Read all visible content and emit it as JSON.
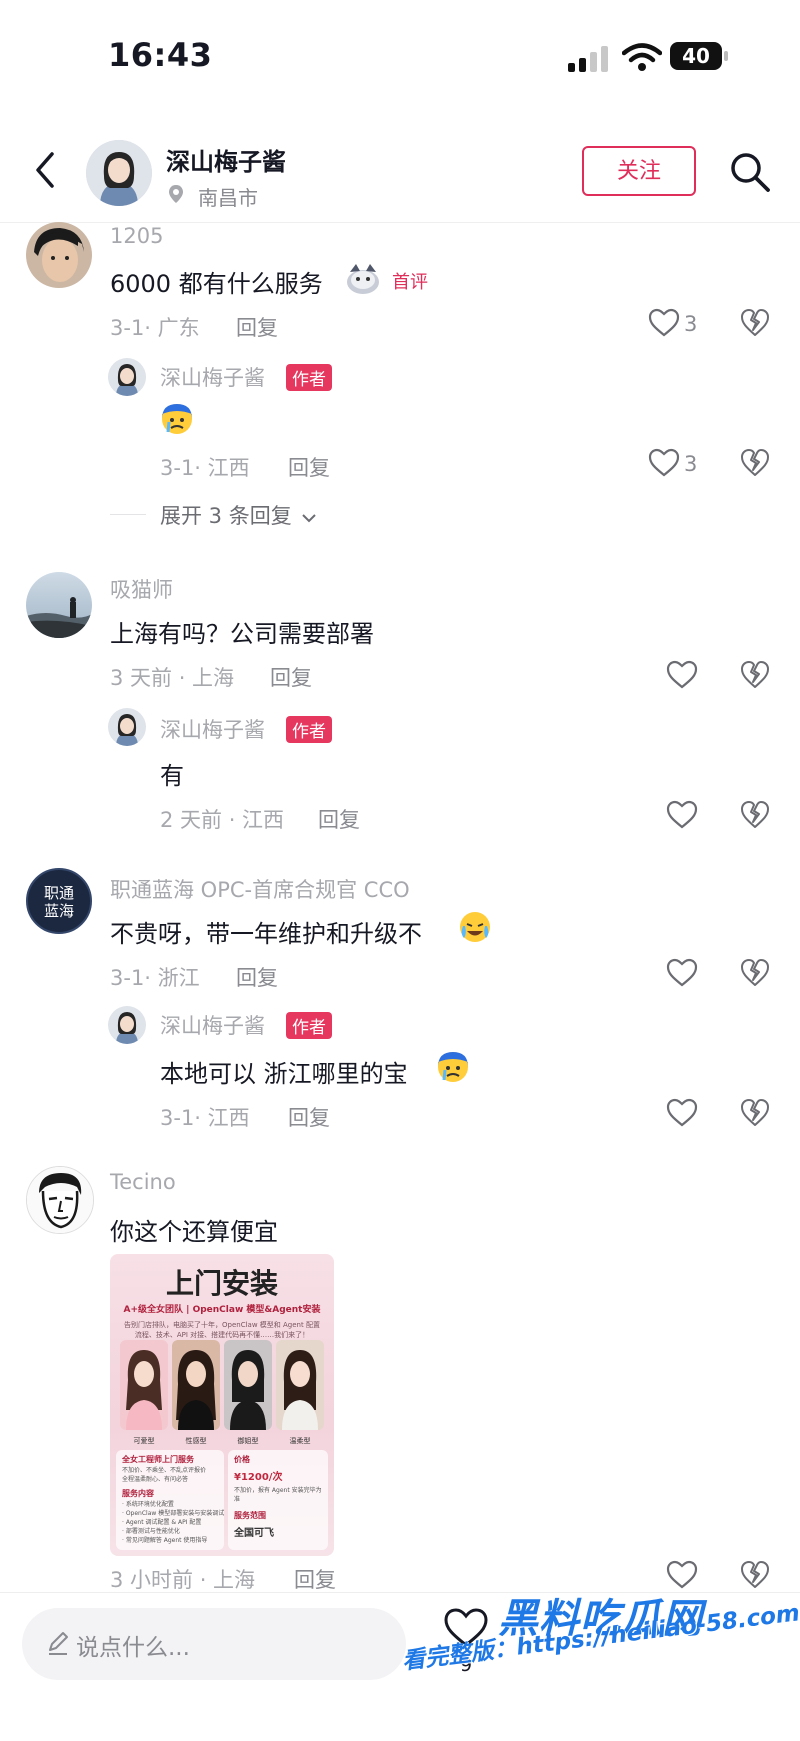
{
  "status_bar": {
    "time": "16:43",
    "battery": "40"
  },
  "header": {
    "name": "深山梅子酱",
    "location": "南昌市",
    "follow_label": "关注"
  },
  "comments": [
    {
      "user": "1205",
      "text": "6000 都有什么服务",
      "tag": "首评",
      "meta": "3-1· 广东",
      "reply_label": "回复",
      "likes": "3",
      "replies": [
        {
          "user": "深山梅子酱",
          "badge": "作者",
          "text": "",
          "meta": "3-1· 江西",
          "reply_label": "回复",
          "likes": "3"
        }
      ],
      "expand_label": "展开 3 条回复"
    },
    {
      "user": "吸猫师",
      "text": "上海有吗？公司需要部署",
      "meta": "3 天前 · 上海",
      "reply_label": "回复",
      "replies": [
        {
          "user": "深山梅子酱",
          "badge": "作者",
          "text": "有",
          "meta": "2 天前 · 江西",
          "reply_label": "回复"
        }
      ]
    },
    {
      "user": "职通蓝海 OPC-首席合规官 CCO",
      "avatar_text": [
        "职通",
        "蓝海"
      ],
      "text": "不贵呀，带一年维护和升级不",
      "meta": "3-1· 浙江",
      "reply_label": "回复",
      "replies": [
        {
          "user": "深山梅子酱",
          "badge": "作者",
          "text": "本地可以 浙江哪里的宝",
          "meta": "3-1· 江西",
          "reply_label": "回复"
        }
      ]
    },
    {
      "user": "Tecino",
      "text": "你这个还算便宜",
      "meta": "3 小时前 · 上海",
      "reply_label": "回复",
      "image": {
        "title": "上门安装",
        "subtitle": "A+级全女团队 | OpenClaw 模型&Agent安装",
        "description": "告别门店排队，电脑买了十年，OpenClaw 模型和 Agent 配置 流程、技术、API 对接、搭建代码再不懂……我们来了！",
        "types": [
          "可爱型",
          "性感型",
          "御姐型",
          "温柔型"
        ],
        "service_title": "全女工程师上门服务",
        "service_lines": [
          "不加价、不乘坐、不乱点评报价",
          "全程温柔耐心、有问必答"
        ],
        "content_title": "服务内容",
        "content_lines": [
          "· 系统环境优化配置",
          "· OpenClaw 模型部署安装与安装调试",
          "· Agent 调试配置 & API 配置",
          "· 部署测试与性能优化",
          "· 常见问题解答 Agent 使用指导"
        ],
        "price_title": "价格",
        "price": "¥1200/次",
        "price_note": "不加价，报有 Agent 安装完毕为准",
        "range_title": "服务范围",
        "range": "全国可飞"
      }
    }
  ],
  "bottom_bar": {
    "input_placeholder": "说点什么...",
    "like_count": "9"
  },
  "watermark": {
    "title": "黑料吃瓜网",
    "url": "看完整版：https://heiliao-58.com"
  },
  "colors": {
    "accent": "#e02e5b",
    "author_badge": "#e6375f",
    "watermark": "#1e78e6"
  }
}
